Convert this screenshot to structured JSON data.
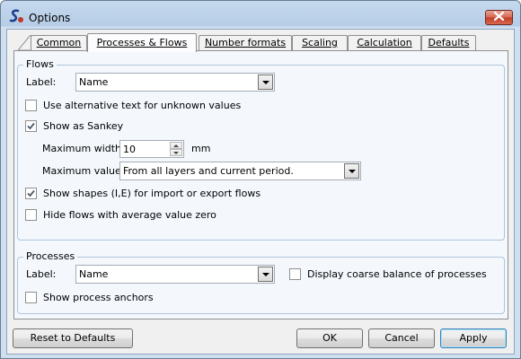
{
  "window": {
    "title": "Options"
  },
  "tabs": [
    {
      "label": "Common",
      "active": false
    },
    {
      "label": "Processes & Flows",
      "active": true
    },
    {
      "label": "Number formats",
      "active": false
    },
    {
      "label": "Scaling",
      "active": false
    },
    {
      "label": "Calculation",
      "active": false
    },
    {
      "label": "Defaults",
      "active": false
    }
  ],
  "flows": {
    "group_title": "Flows",
    "label_caption": "Label:",
    "label_value": "Name",
    "alt_text": {
      "label": "Use alternative text for unknown values",
      "checked": false
    },
    "show_sankey": {
      "label": "Show as Sankey",
      "checked": true
    },
    "max_width_caption": "Maximum width:",
    "max_width_value": "10",
    "max_width_unit": "mm",
    "max_value_caption": "Maximum value:",
    "max_value_value": "From all layers and current period.",
    "show_shapes": {
      "label": "Show shapes (I,E) for import or export flows",
      "checked": true
    },
    "hide_zero": {
      "label": "Hide flows with average value zero",
      "checked": false
    }
  },
  "processes": {
    "group_title": "Processes",
    "label_caption": "Label:",
    "label_value": "Name",
    "coarse_balance": {
      "label": "Display coarse balance of processes",
      "checked": false
    },
    "show_anchors": {
      "label": "Show process anchors",
      "checked": false
    }
  },
  "buttons": {
    "reset": "Reset to Defaults",
    "ok": "OK",
    "cancel": "Cancel",
    "apply": "Apply"
  },
  "colors": {
    "title_bar": "#c5d9ee",
    "close_button": "#c2402a",
    "panel": "#f4f8fd",
    "group_border": "#b0c4da"
  }
}
